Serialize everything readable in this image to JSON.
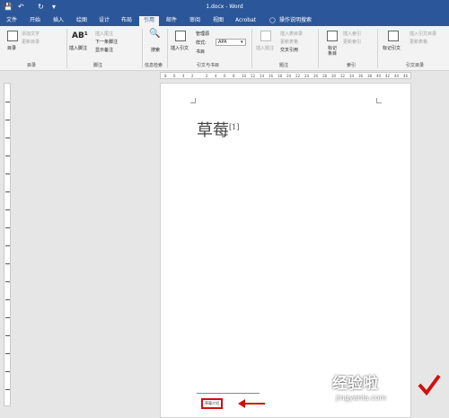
{
  "title_bar": {
    "document_title": "1.docx - Word"
  },
  "quick_access": {
    "save_icon": "save-icon",
    "undo_icon": "undo-icon",
    "redo_icon": "redo-icon",
    "customize_icon": "chevron-down-icon"
  },
  "menu": {
    "tabs": [
      "文件",
      "开始",
      "插入",
      "绘图",
      "设计",
      "布局",
      "引用",
      "邮件",
      "审阅",
      "视图",
      "Acrobat"
    ],
    "active_tab": "引用",
    "tell_me": "操作说明搜索"
  },
  "ribbon": {
    "toc": {
      "button": "目录",
      "add_text": "添加文字",
      "update_toc": "更新目录",
      "group_label": "目录"
    },
    "footnotes": {
      "insert_footnote": "插入脚注",
      "insert_endnote": "插入尾注",
      "next_footnote": "下一条脚注",
      "show_notes": "显示备注",
      "group_label": "脚注"
    },
    "research": {
      "search": "搜索",
      "group_label": "信息检索"
    },
    "citations": {
      "insert_citation": "插入引文",
      "manage_sources": "管理源",
      "style_label": "样式:",
      "style_value": "APA",
      "bibliography": "书目",
      "group_label": "引文与书目"
    },
    "captions": {
      "insert_caption": "插入题注",
      "insert_table_of_figures": "插入表目录",
      "update_table": "更新表格",
      "cross_reference": "交叉引用",
      "group_label": "题注"
    },
    "index": {
      "mark_entry": "标记条目",
      "insert_index": "插入索引",
      "update_index": "更新索引",
      "group_label": "索引"
    },
    "table_of_authorities": {
      "mark_citation": "标记引文",
      "insert_table": "插入引文目录",
      "update_table": "更新表格",
      "group_label": "引文目录"
    }
  },
  "ruler": {
    "ticks": [
      "8",
      "6",
      "4",
      "2",
      "2",
      "4",
      "6",
      "8",
      "10",
      "12",
      "14",
      "16",
      "18",
      "20",
      "22",
      "24",
      "26",
      "28",
      "30",
      "32",
      "34",
      "36",
      "38",
      "40",
      "42",
      "44",
      "46"
    ]
  },
  "document": {
    "main_text": "草莓",
    "footnote_ref": "[1]",
    "footnote_text": "草莓介绍"
  },
  "watermark": {
    "text": "经验啦",
    "url": "jingyanla.com"
  },
  "colors": {
    "accent": "#2b579a",
    "highlight": "#d01010",
    "ribbon_bg": "#f3f3f3",
    "workspace": "#e6e6e6"
  }
}
